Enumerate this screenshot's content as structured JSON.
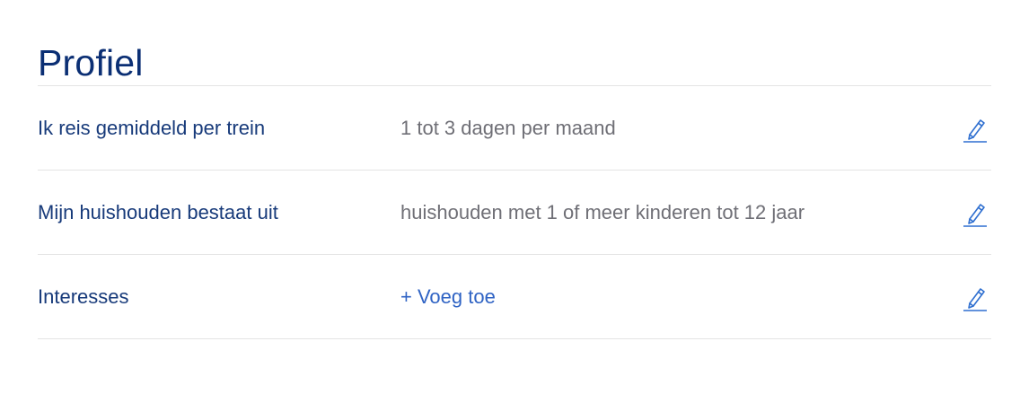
{
  "page": {
    "title": "Profiel"
  },
  "rows": [
    {
      "label": "Ik reis gemiddeld per trein",
      "value": "1 tot 3 dagen per maand",
      "value_type": "text",
      "edit_icon": "pencil-icon"
    },
    {
      "label": "Mijn huishouden bestaat uit",
      "value": "huishouden met 1 of meer kinderen tot 12 jaar",
      "value_type": "text",
      "edit_icon": "pencil-icon"
    },
    {
      "label": "Interesses",
      "value": "+ Voeg toe",
      "value_type": "link",
      "edit_icon": "pencil-icon"
    }
  ],
  "colors": {
    "title": "#0b2f74",
    "label": "#173a7a",
    "value": "#6f6f76",
    "link": "#2f63c4",
    "icon": "#2f6fd0",
    "divider": "#e4e4e4"
  }
}
